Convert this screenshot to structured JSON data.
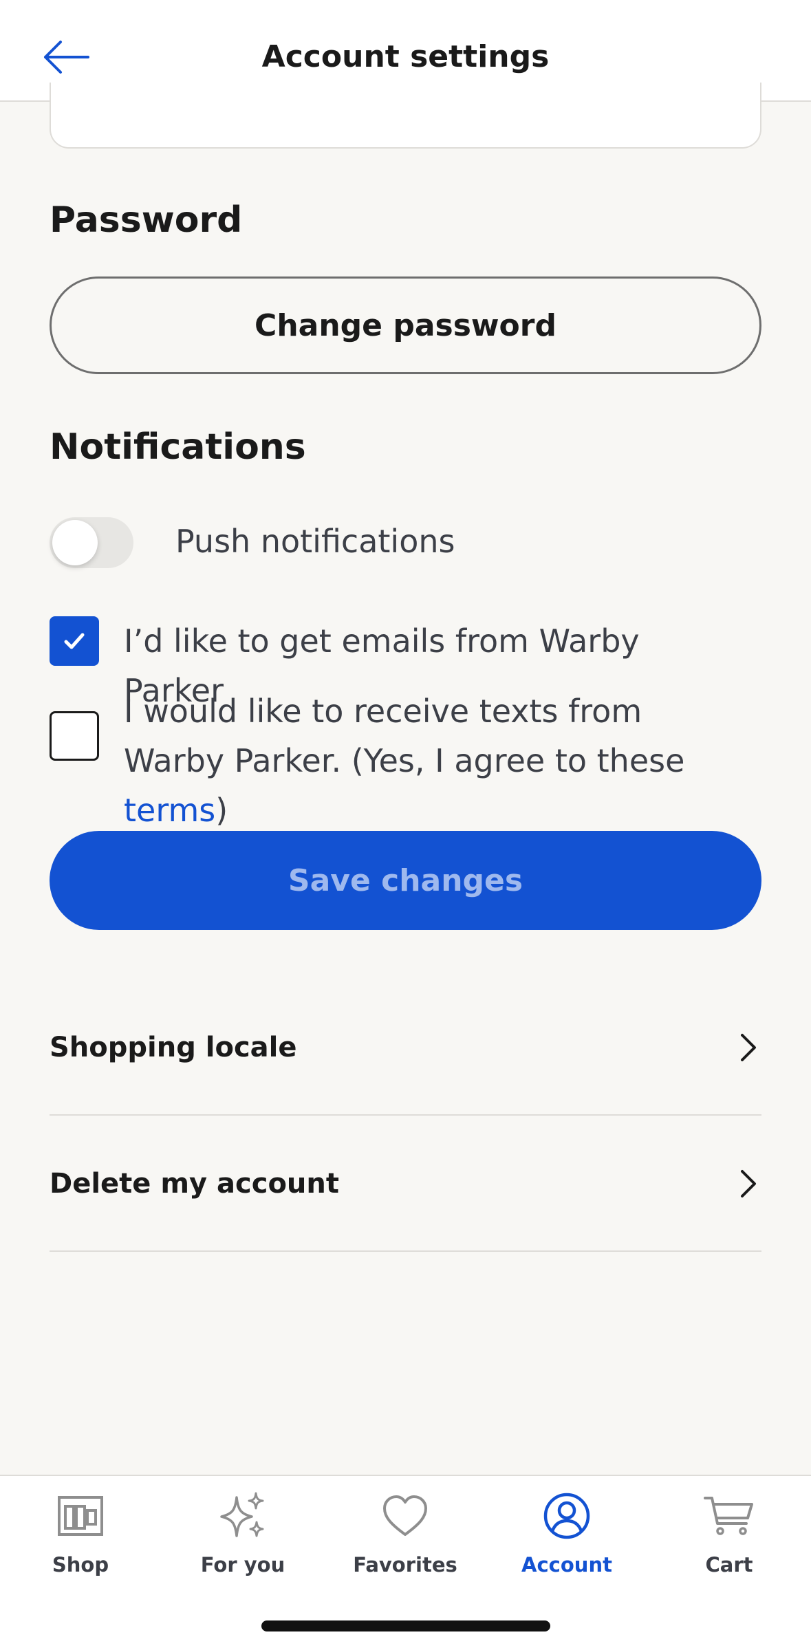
{
  "header": {
    "title": "Account settings"
  },
  "password": {
    "title": "Password",
    "change_label": "Change password"
  },
  "notifications": {
    "title": "Notifications",
    "push_label": "Push notifications",
    "push_enabled": false,
    "email_opt_in": {
      "label": "I’d like to get emails from Warby Parker",
      "checked": true
    },
    "texts_opt_in": {
      "label_before": "I would like to receive texts from Warby Parker. (Yes, I agree to these ",
      "link": "terms",
      "label_after": ")",
      "checked": false
    }
  },
  "save_label": "Save changes",
  "settings_list": [
    {
      "label": "Shopping locale"
    },
    {
      "label": "Delete my account"
    }
  ],
  "tabbar": {
    "items": [
      {
        "label": "Shop",
        "icon": "shop-icon"
      },
      {
        "label": "For you",
        "icon": "sparkle-icon"
      },
      {
        "label": "Favorites",
        "icon": "heart-icon"
      },
      {
        "label": "Account",
        "icon": "account-icon",
        "active": true
      },
      {
        "label": "Cart",
        "icon": "cart-icon"
      }
    ]
  },
  "colors": {
    "accent": "#1352d2",
    "background": "#f8f7f4",
    "text": "#1a1a1a",
    "muted_text": "#3c3f47"
  }
}
